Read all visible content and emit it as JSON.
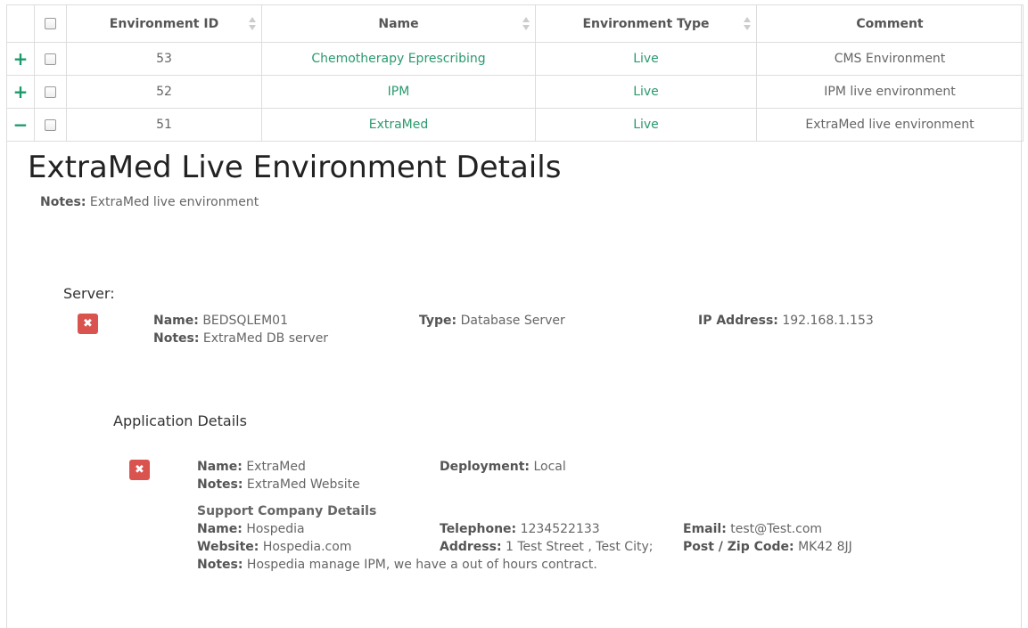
{
  "table": {
    "headers": [
      "Environment ID",
      "Name",
      "Environment Type",
      "Comment"
    ],
    "rows": [
      {
        "expander": "+",
        "id": "53",
        "name": "Chemotherapy Eprescribing",
        "type": "Live",
        "comment": "CMS Environment"
      },
      {
        "expander": "+",
        "id": "52",
        "name": "IPM",
        "type": "Live",
        "comment": "IPM live environment"
      },
      {
        "expander": "−",
        "id": "51",
        "name": "ExtraMed",
        "type": "Live",
        "comment": "ExtraMed live environment"
      }
    ]
  },
  "detail": {
    "title": "ExtraMed Live Environment Details",
    "notes_label": "Notes:",
    "notes_value": "ExtraMed live environment",
    "server_heading": "Server:",
    "server": {
      "delete_icon": "✖",
      "name_label": "Name:",
      "name_value": "BEDSQLEM01",
      "notes_label": "Notes:",
      "notes_value": "ExtraMed DB server",
      "type_label": "Type:",
      "type_value": "Database Server",
      "ip_label": "IP Address:",
      "ip_value": "192.168.1.153"
    },
    "app_heading": "Application Details",
    "app": {
      "delete_icon": "✖",
      "name_label": "Name:",
      "name_value": "ExtraMed",
      "notes_label": "Notes:",
      "notes_value": "ExtraMed Website",
      "deployment_label": "Deployment:",
      "deployment_value": "Local",
      "support_heading": "Support Company Details",
      "support_name_label": "Name:",
      "support_name_value": "Hospedia",
      "website_label": "Website:",
      "website_value": "Hospedia.com",
      "support_notes_label": "Notes:",
      "support_notes_value": "Hospedia manage IPM, we have a out of hours contract.",
      "telephone_label": "Telephone:",
      "telephone_value": "1234522133",
      "address_label": "Address:",
      "address_value": "1 Test Street , Test City;",
      "email_label": "Email:",
      "email_value": "test@Test.com",
      "postcode_label": "Post / Zip Code:",
      "postcode_value": "MK42 8JJ"
    }
  },
  "colors": {
    "accent": "#2a9a6e",
    "danger": "#d9534f"
  }
}
